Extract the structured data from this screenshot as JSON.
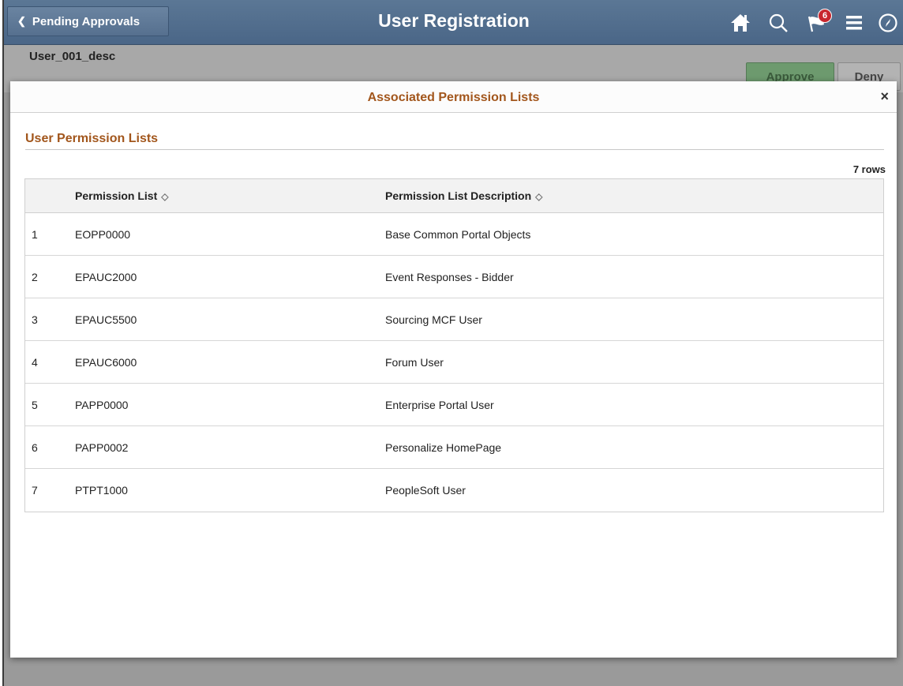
{
  "banner": {
    "back_label": "Pending Approvals",
    "title": "User Registration",
    "notification_count": "6",
    "icons": [
      "home-icon",
      "search-icon",
      "flag-icon",
      "menu-icon",
      "navbar-compass-icon"
    ]
  },
  "page": {
    "user_desc": "User_001_desc",
    "approve_label": "Approve",
    "deny_label": "Deny"
  },
  "modal": {
    "title": "Associated Permission Lists",
    "close_label": "×",
    "section_title": "User Permission Lists",
    "row_count": "7 rows",
    "columns": [
      "Permission List",
      "Permission List Description"
    ],
    "rows": [
      {
        "num": "1",
        "list": "EOPP0000",
        "desc": "Base Common Portal Objects"
      },
      {
        "num": "2",
        "list": "EPAUC2000",
        "desc": "Event Responses - Bidder"
      },
      {
        "num": "3",
        "list": "EPAUC5500",
        "desc": "Sourcing MCF User"
      },
      {
        "num": "4",
        "list": "EPAUC6000",
        "desc": "Forum User"
      },
      {
        "num": "5",
        "list": "PAPP0000",
        "desc": "Enterprise Portal User"
      },
      {
        "num": "6",
        "list": "PAPP0002",
        "desc": "Personalize HomePage"
      },
      {
        "num": "7",
        "list": "PTPT1000",
        "desc": "PeopleSoft User"
      }
    ]
  },
  "colors": {
    "banner": "#4f6b8b",
    "accent_title": "#a2561c",
    "badge": "#c8262d"
  }
}
